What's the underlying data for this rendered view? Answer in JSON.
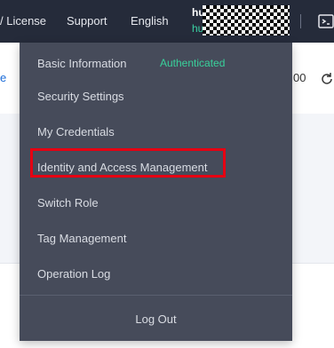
{
  "topbar": {
    "nav": [
      "/ License",
      "Support",
      "English"
    ],
    "user_name": "hu",
    "user_id": "hu",
    "console_icon": "terminal-icon"
  },
  "page": {
    "left_text": "e",
    "right_text": "00",
    "refresh_icon": "refresh-icon"
  },
  "dropdown": {
    "basic_info": "Basic Information",
    "status": "Authenticated",
    "items": [
      "Security Settings",
      "My Credentials",
      "Identity and Access Management",
      "Switch Role",
      "Tag Management",
      "Operation Log"
    ],
    "logout": "Log Out"
  },
  "colors": {
    "topbar": "#252b3a",
    "dropdown": "#464b5a",
    "status": "#39d19b",
    "highlight": "#e60012"
  }
}
